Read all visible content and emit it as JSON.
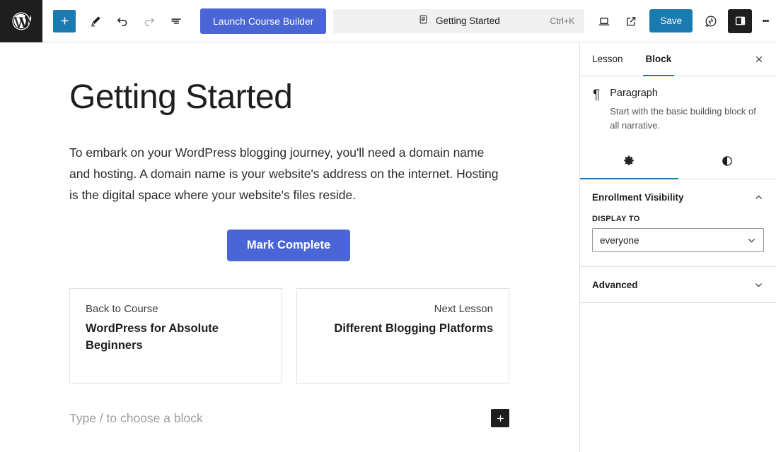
{
  "toolbar": {
    "logo_label": "wordpress-logo",
    "add_block_label": "+",
    "edit_tool_label": "edit-tool",
    "undo_label": "undo",
    "redo_label": "redo",
    "list_view_label": "document-overview",
    "builder_button": "Launch Course Builder",
    "command_bar": {
      "title": "Getting Started",
      "shortcut": "Ctrl+K"
    },
    "preview_label": "preview",
    "view_label": "view-external",
    "save_label": "Save",
    "jetpack_label": "jetpack",
    "sidebar_toggle_label": "settings-sidebar",
    "options_label": "options"
  },
  "editor": {
    "title": "Getting Started",
    "paragraph": "To embark on your WordPress blogging journey, you'll need a domain name and hosting. A domain name is your website's address on the internet. Hosting is the digital space where your website's files reside.",
    "mark_complete": "Mark Complete",
    "nav_cards": [
      {
        "kicker": "Back to Course",
        "name": "WordPress for Absolute Beginners"
      },
      {
        "kicker": "Next Lesson",
        "name": "Different Blogging Platforms"
      }
    ],
    "empty_block_placeholder": "Type / to choose a block",
    "appender_label": "+"
  },
  "sidebar": {
    "tabs": [
      {
        "label": "Lesson",
        "active": false
      },
      {
        "label": "Block",
        "active": true
      }
    ],
    "close_label": "×",
    "block": {
      "icon": "¶",
      "title": "Paragraph",
      "description": "Start with the basic building block of all narrative."
    },
    "icon_tabs": [
      {
        "name": "settings-tab",
        "active": true
      },
      {
        "name": "styles-tab",
        "active": false
      }
    ],
    "panels": [
      {
        "title": "Enrollment Visibility",
        "expanded": true,
        "field_label": "DISPLAY TO",
        "field_value": "everyone"
      },
      {
        "title": "Advanced",
        "expanded": false
      }
    ]
  },
  "colors": {
    "accent_blue": "#1a7bb0",
    "brand_button": "#4a66d6",
    "dark": "#1e1e1e",
    "border": "#e0e0e0"
  }
}
